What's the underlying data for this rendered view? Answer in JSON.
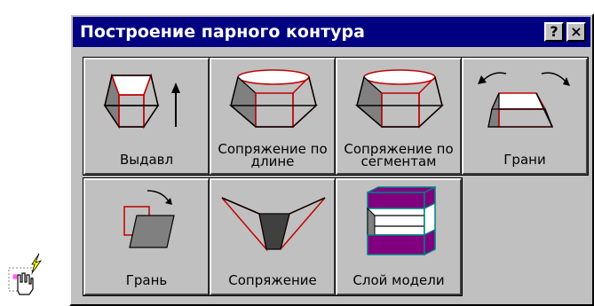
{
  "window": {
    "title": "Построение парного контура",
    "help_label": "?",
    "close_label": "×"
  },
  "tools": [
    {
      "label": "Выдавл",
      "icon": "extrude-icon"
    },
    {
      "label": "Сопряжение по длине",
      "icon": "blend-by-length-icon"
    },
    {
      "label": "Сопряжение по сегментам",
      "icon": "blend-by-segments-icon"
    },
    {
      "label": "Грани",
      "icon": "faces-icon"
    },
    {
      "label": "Грань",
      "icon": "face-icon"
    },
    {
      "label": "Сопряжение",
      "icon": "blend-icon"
    },
    {
      "label": "Слой модели",
      "icon": "model-layer-icon"
    }
  ],
  "colors": {
    "titlebar": "#000080",
    "face": "#c0c0c0",
    "edge": "#c00000",
    "model_layer": "#800080"
  }
}
